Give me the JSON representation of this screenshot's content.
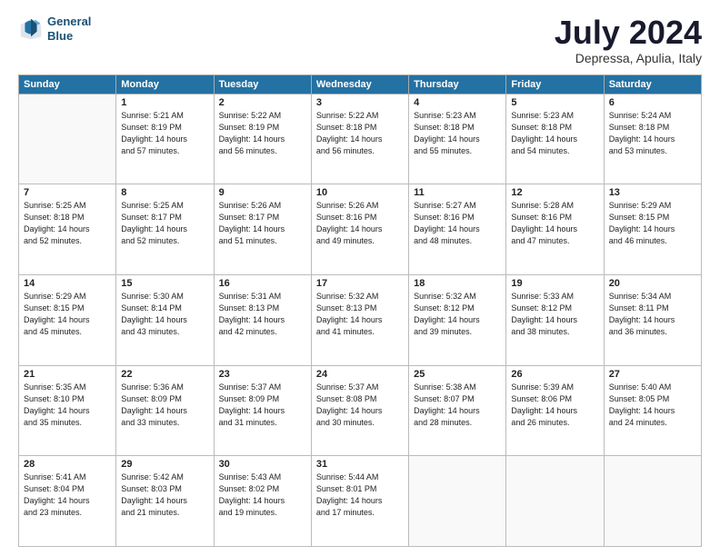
{
  "logo": {
    "line1": "General",
    "line2": "Blue"
  },
  "title": "July 2024",
  "location": "Depressa, Apulia, Italy",
  "weekdays": [
    "Sunday",
    "Monday",
    "Tuesday",
    "Wednesday",
    "Thursday",
    "Friday",
    "Saturday"
  ],
  "weeks": [
    [
      {
        "num": "",
        "info": ""
      },
      {
        "num": "1",
        "info": "Sunrise: 5:21 AM\nSunset: 8:19 PM\nDaylight: 14 hours\nand 57 minutes."
      },
      {
        "num": "2",
        "info": "Sunrise: 5:22 AM\nSunset: 8:19 PM\nDaylight: 14 hours\nand 56 minutes."
      },
      {
        "num": "3",
        "info": "Sunrise: 5:22 AM\nSunset: 8:18 PM\nDaylight: 14 hours\nand 56 minutes."
      },
      {
        "num": "4",
        "info": "Sunrise: 5:23 AM\nSunset: 8:18 PM\nDaylight: 14 hours\nand 55 minutes."
      },
      {
        "num": "5",
        "info": "Sunrise: 5:23 AM\nSunset: 8:18 PM\nDaylight: 14 hours\nand 54 minutes."
      },
      {
        "num": "6",
        "info": "Sunrise: 5:24 AM\nSunset: 8:18 PM\nDaylight: 14 hours\nand 53 minutes."
      }
    ],
    [
      {
        "num": "7",
        "info": "Sunrise: 5:25 AM\nSunset: 8:18 PM\nDaylight: 14 hours\nand 52 minutes."
      },
      {
        "num": "8",
        "info": "Sunrise: 5:25 AM\nSunset: 8:17 PM\nDaylight: 14 hours\nand 52 minutes."
      },
      {
        "num": "9",
        "info": "Sunrise: 5:26 AM\nSunset: 8:17 PM\nDaylight: 14 hours\nand 51 minutes."
      },
      {
        "num": "10",
        "info": "Sunrise: 5:26 AM\nSunset: 8:16 PM\nDaylight: 14 hours\nand 49 minutes."
      },
      {
        "num": "11",
        "info": "Sunrise: 5:27 AM\nSunset: 8:16 PM\nDaylight: 14 hours\nand 48 minutes."
      },
      {
        "num": "12",
        "info": "Sunrise: 5:28 AM\nSunset: 8:16 PM\nDaylight: 14 hours\nand 47 minutes."
      },
      {
        "num": "13",
        "info": "Sunrise: 5:29 AM\nSunset: 8:15 PM\nDaylight: 14 hours\nand 46 minutes."
      }
    ],
    [
      {
        "num": "14",
        "info": "Sunrise: 5:29 AM\nSunset: 8:15 PM\nDaylight: 14 hours\nand 45 minutes."
      },
      {
        "num": "15",
        "info": "Sunrise: 5:30 AM\nSunset: 8:14 PM\nDaylight: 14 hours\nand 43 minutes."
      },
      {
        "num": "16",
        "info": "Sunrise: 5:31 AM\nSunset: 8:13 PM\nDaylight: 14 hours\nand 42 minutes."
      },
      {
        "num": "17",
        "info": "Sunrise: 5:32 AM\nSunset: 8:13 PM\nDaylight: 14 hours\nand 41 minutes."
      },
      {
        "num": "18",
        "info": "Sunrise: 5:32 AM\nSunset: 8:12 PM\nDaylight: 14 hours\nand 39 minutes."
      },
      {
        "num": "19",
        "info": "Sunrise: 5:33 AM\nSunset: 8:12 PM\nDaylight: 14 hours\nand 38 minutes."
      },
      {
        "num": "20",
        "info": "Sunrise: 5:34 AM\nSunset: 8:11 PM\nDaylight: 14 hours\nand 36 minutes."
      }
    ],
    [
      {
        "num": "21",
        "info": "Sunrise: 5:35 AM\nSunset: 8:10 PM\nDaylight: 14 hours\nand 35 minutes."
      },
      {
        "num": "22",
        "info": "Sunrise: 5:36 AM\nSunset: 8:09 PM\nDaylight: 14 hours\nand 33 minutes."
      },
      {
        "num": "23",
        "info": "Sunrise: 5:37 AM\nSunset: 8:09 PM\nDaylight: 14 hours\nand 31 minutes."
      },
      {
        "num": "24",
        "info": "Sunrise: 5:37 AM\nSunset: 8:08 PM\nDaylight: 14 hours\nand 30 minutes."
      },
      {
        "num": "25",
        "info": "Sunrise: 5:38 AM\nSunset: 8:07 PM\nDaylight: 14 hours\nand 28 minutes."
      },
      {
        "num": "26",
        "info": "Sunrise: 5:39 AM\nSunset: 8:06 PM\nDaylight: 14 hours\nand 26 minutes."
      },
      {
        "num": "27",
        "info": "Sunrise: 5:40 AM\nSunset: 8:05 PM\nDaylight: 14 hours\nand 24 minutes."
      }
    ],
    [
      {
        "num": "28",
        "info": "Sunrise: 5:41 AM\nSunset: 8:04 PM\nDaylight: 14 hours\nand 23 minutes."
      },
      {
        "num": "29",
        "info": "Sunrise: 5:42 AM\nSunset: 8:03 PM\nDaylight: 14 hours\nand 21 minutes."
      },
      {
        "num": "30",
        "info": "Sunrise: 5:43 AM\nSunset: 8:02 PM\nDaylight: 14 hours\nand 19 minutes."
      },
      {
        "num": "31",
        "info": "Sunrise: 5:44 AM\nSunset: 8:01 PM\nDaylight: 14 hours\nand 17 minutes."
      },
      {
        "num": "",
        "info": ""
      },
      {
        "num": "",
        "info": ""
      },
      {
        "num": "",
        "info": ""
      }
    ]
  ]
}
